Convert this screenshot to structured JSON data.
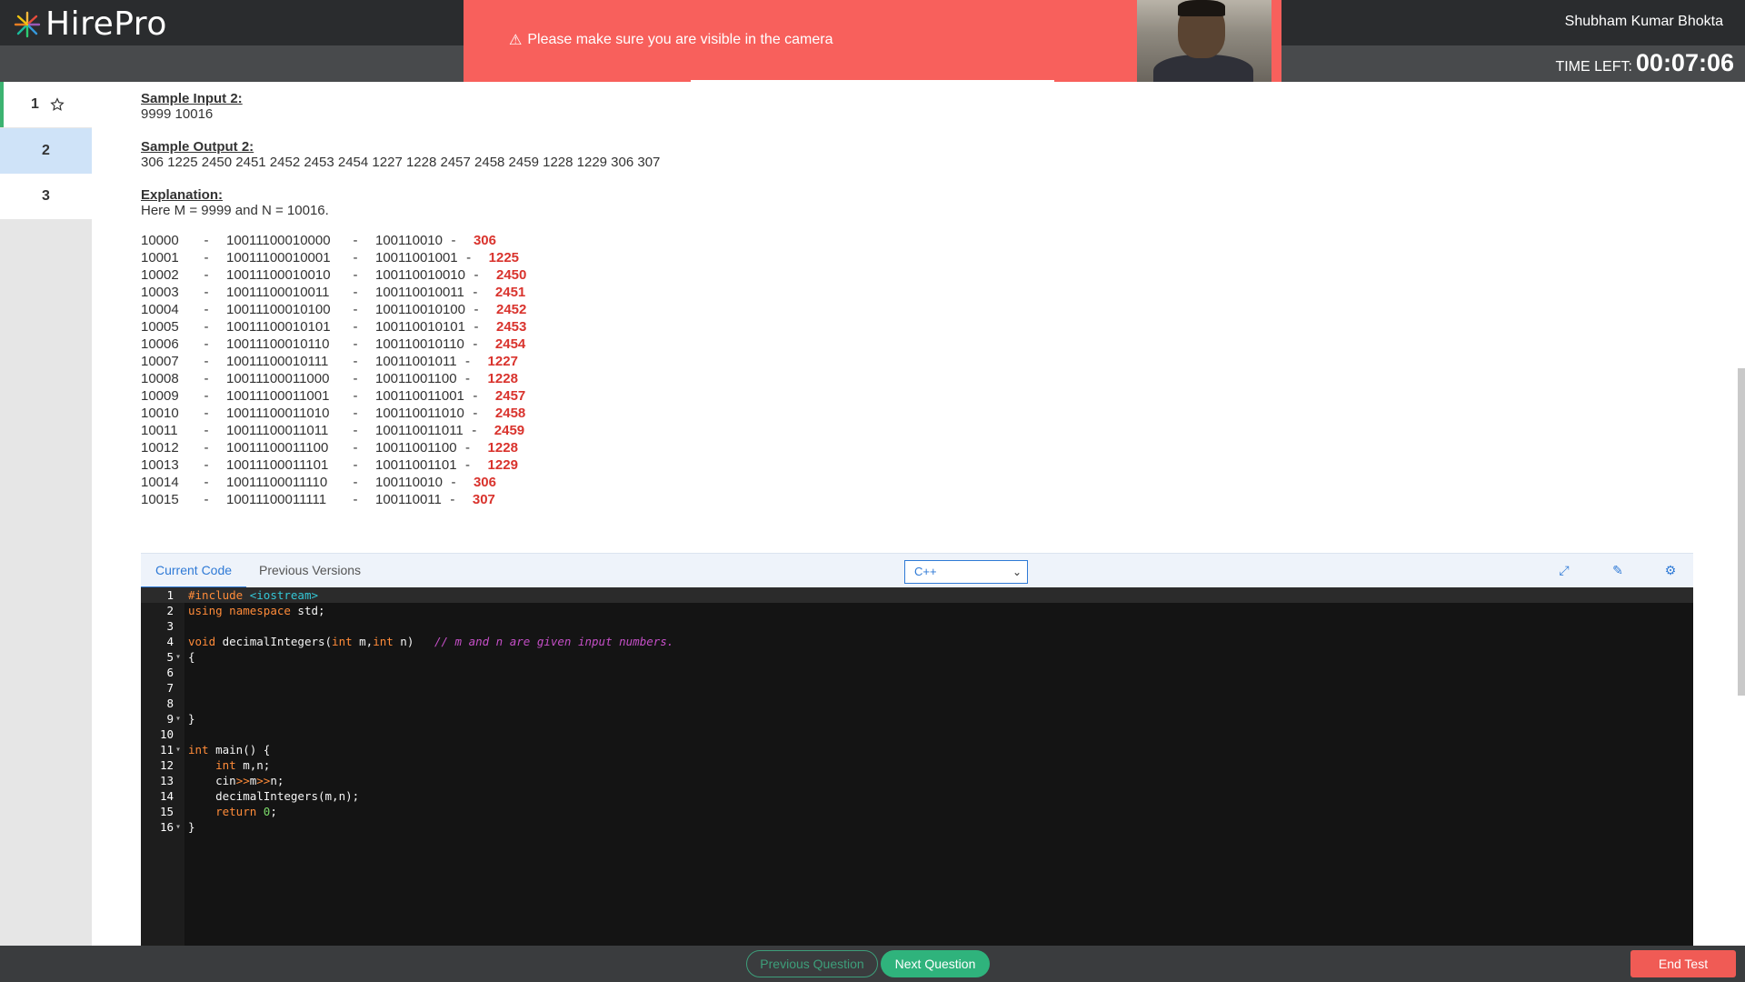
{
  "header": {
    "brand": "HirePro",
    "user_name": "Shubham Kumar Bhokta",
    "time_left_label": "TIME LEFT:",
    "time_left_value": "00:07:06"
  },
  "alert": {
    "message": "Please make sure you are visible in the camera",
    "icon": "warning-icon"
  },
  "sidebar": {
    "questions": [
      "1",
      "2",
      "3"
    ]
  },
  "question": {
    "sample_input_title": "Sample Input 2:",
    "sample_input_value": "9999 10016",
    "sample_output_title": "Sample Output 2:",
    "sample_output_value": "306 1225 2450 2451 2452 2453 2454 1227 1228 2457 2458 2459 1228 1229 306 307",
    "explanation_title": "Explanation:",
    "explanation_text": "Here M = 9999 and N = 10016.",
    "rows": [
      {
        "dec": "10000",
        "bin": "10011100010000",
        "mid": "100110010",
        "res": "306"
      },
      {
        "dec": "10001",
        "bin": "10011100010001",
        "mid": "10011001001",
        "res": "1225"
      },
      {
        "dec": "10002",
        "bin": "10011100010010",
        "mid": "100110010010",
        "res": "2450"
      },
      {
        "dec": "10003",
        "bin": "10011100010011",
        "mid": "100110010011",
        "res": "2451"
      },
      {
        "dec": "10004",
        "bin": "10011100010100",
        "mid": "100110010100",
        "res": "2452"
      },
      {
        "dec": "10005",
        "bin": "10011100010101",
        "mid": "100110010101",
        "res": "2453"
      },
      {
        "dec": "10006",
        "bin": "10011100010110",
        "mid": "100110010110",
        "res": "2454"
      },
      {
        "dec": "10007",
        "bin": "10011100010111",
        "mid": "10011001011",
        "res": "1227"
      },
      {
        "dec": "10008",
        "bin": "10011100011000",
        "mid": "10011001100",
        "res": "1228"
      },
      {
        "dec": "10009",
        "bin": "10011100011001",
        "mid": "100110011001",
        "res": "2457"
      },
      {
        "dec": "10010",
        "bin": "10011100011010",
        "mid": "100110011010",
        "res": "2458"
      },
      {
        "dec": "10011",
        "bin": "10011100011011",
        "mid": "100110011011",
        "res": "2459"
      },
      {
        "dec": "10012",
        "bin": "10011100011100",
        "mid": "10011001100",
        "res": "1228"
      },
      {
        "dec": "10013",
        "bin": "10011100011101",
        "mid": "10011001101",
        "res": "1229"
      },
      {
        "dec": "10014",
        "bin": "10011100011110",
        "mid": "100110010",
        "res": "306"
      },
      {
        "dec": "10015",
        "bin": "10011100011111",
        "mid": "100110011",
        "res": "307"
      }
    ]
  },
  "editor": {
    "tab_current": "Current Code",
    "tab_previous": "Previous Versions",
    "language": "C++",
    "lines": [
      {
        "n": "1",
        "fold": false,
        "html": "<span class=\"inc\">#include</span> <span class=\"hdr\">&lt;iostream&gt;</span>"
      },
      {
        "n": "2",
        "fold": false,
        "html": "<span class=\"kw\">using</span> <span class=\"kw\">namespace</span> std;"
      },
      {
        "n": "3",
        "fold": false,
        "html": ""
      },
      {
        "n": "4",
        "fold": false,
        "html": "<span class=\"kw\">void</span> decimalIntegers(<span class=\"kw\">int</span> m,<span class=\"kw\">int</span> n)   <span class=\"cm\">// m and n are given input numbers.</span>"
      },
      {
        "n": "5",
        "fold": true,
        "html": "{"
      },
      {
        "n": "6",
        "fold": false,
        "html": ""
      },
      {
        "n": "7",
        "fold": false,
        "html": ""
      },
      {
        "n": "8",
        "fold": false,
        "html": ""
      },
      {
        "n": "9",
        "fold": true,
        "html": "}"
      },
      {
        "n": "10",
        "fold": false,
        "html": ""
      },
      {
        "n": "11",
        "fold": true,
        "html": "<span class=\"kw\">int</span> main() {"
      },
      {
        "n": "12",
        "fold": false,
        "html": "    <span class=\"kw\">int</span> m,n;"
      },
      {
        "n": "13",
        "fold": false,
        "html": "    cin<span class=\"op\">&gt;&gt;</span>m<span class=\"op\">&gt;&gt;</span>n;"
      },
      {
        "n": "14",
        "fold": false,
        "html": "    decimalIntegers(m,n);"
      },
      {
        "n": "15",
        "fold": false,
        "html": "    <span class=\"kw\">return</span> <span class=\"numlit\">0</span>;"
      },
      {
        "n": "16",
        "fold": true,
        "html": "}"
      }
    ]
  },
  "footer": {
    "previous_label": "Previous Question",
    "next_label": "Next Question",
    "end_label": "End Test"
  }
}
